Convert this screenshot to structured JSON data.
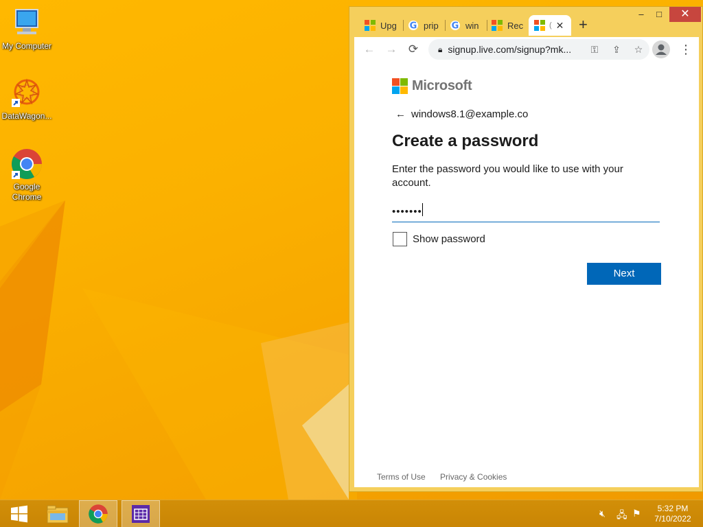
{
  "desktop": {
    "icons": [
      {
        "label": "My Computer"
      },
      {
        "label": "DataWagon..."
      },
      {
        "label": "Google Chrome"
      }
    ]
  },
  "browser": {
    "tabs": [
      {
        "label": "Upg"
      },
      {
        "label": "prip"
      },
      {
        "label": "win"
      },
      {
        "label": "Rec"
      },
      {
        "label": "("
      }
    ],
    "url": "signup.live.com/signup?mk...",
    "window_controls": {
      "minimize": "–",
      "maximize": "□",
      "close": "✕"
    }
  },
  "page": {
    "brand": "Microsoft",
    "identity": "windows8.1@example.co",
    "title": "Create a password",
    "description": "Enter the password you would like to use with your account.",
    "password_value": "•••••••",
    "show_password_label": "Show password",
    "next_label": "Next",
    "footer": {
      "terms": "Terms of Use",
      "privacy": "Privacy & Cookies"
    }
  },
  "taskbar": {
    "time": "5:32 PM",
    "date": "7/10/2022"
  },
  "colors": {
    "accent": "#0067b8",
    "ms_red": "#f25022",
    "ms_green": "#7fba00",
    "ms_blue": "#00a4ef",
    "ms_yellow": "#ffb900"
  }
}
